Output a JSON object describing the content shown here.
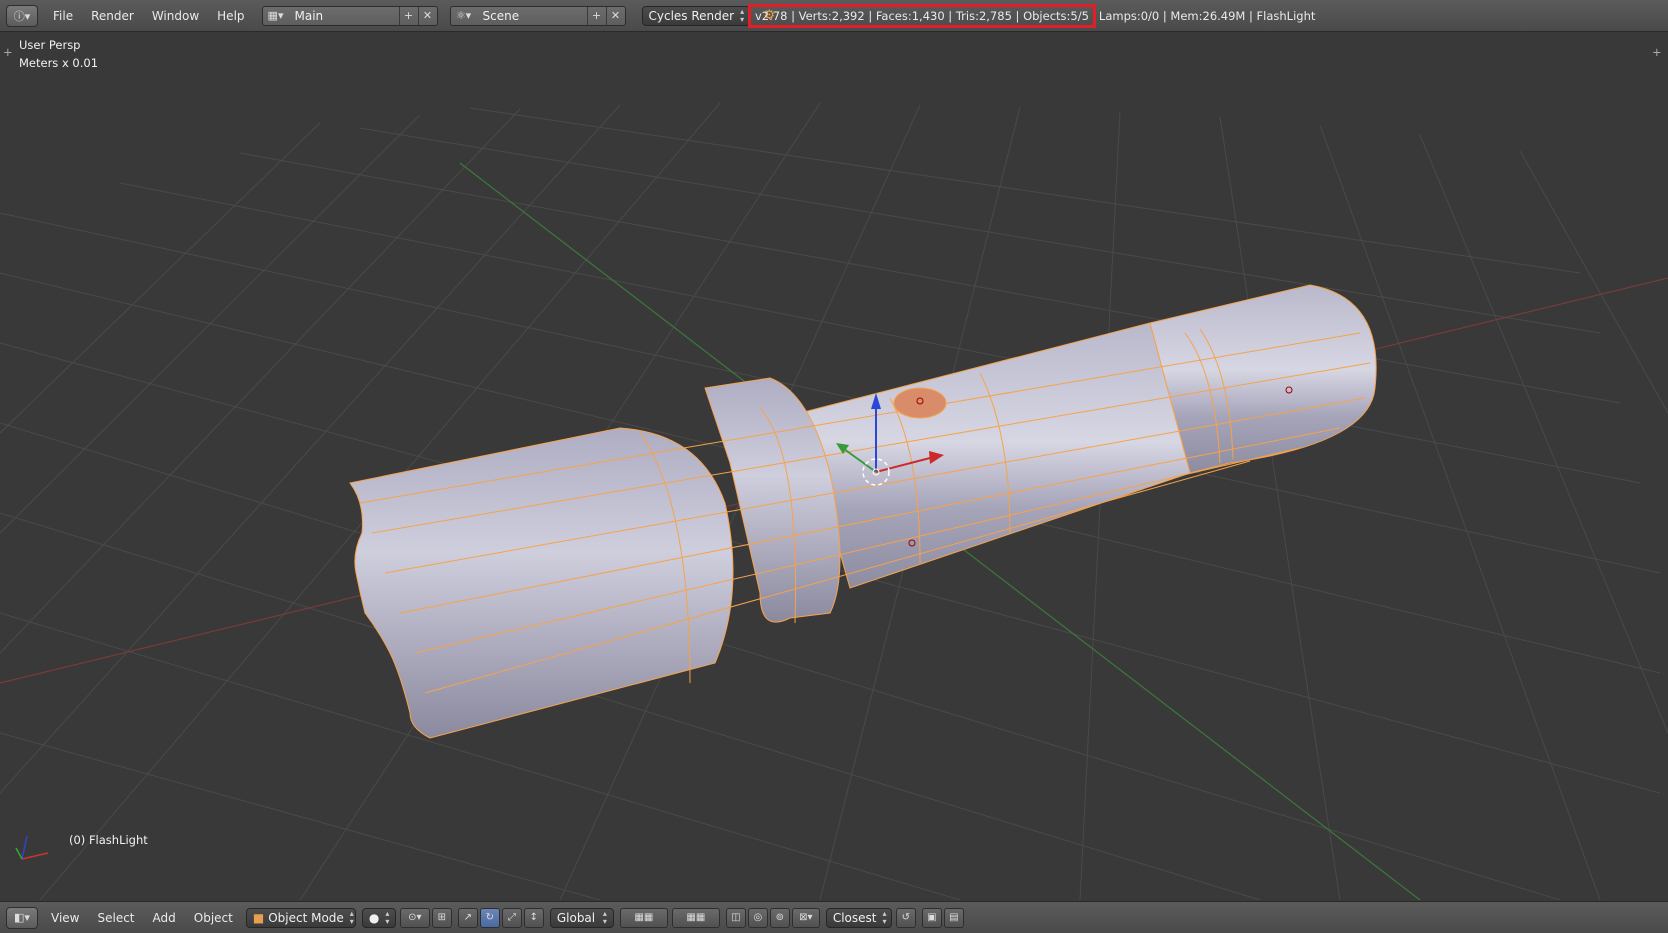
{
  "topbar": {
    "menus": [
      "File",
      "Render",
      "Window",
      "Help"
    ],
    "screen_layout": "Main",
    "scene": "Scene",
    "render_engine": "Cycles Render",
    "stats_highlighted": "v2.78 | Verts:2,392 | Faces:1,430 | Tris:2,785 | Objects:5/5",
    "stats_rest": "Lamps:0/0 | Mem:26.49M | FlashLight",
    "highlight_color": "#e21f26"
  },
  "viewport": {
    "view_name": "User Persp",
    "units": "Meters x 0.01",
    "active_object": "(0) FlashLight",
    "object_wire_color": "#f7a24a",
    "object_body_color": "#b8b7c9",
    "axis_x_color": "#c33",
    "axis_y_color": "#3a9a3a",
    "axis_z_color": "#2b47d6"
  },
  "bottombar": {
    "menus": [
      "View",
      "Select",
      "Add",
      "Object"
    ],
    "mode": "Object Mode",
    "orientation": "Global",
    "snap_target": "Closest"
  }
}
